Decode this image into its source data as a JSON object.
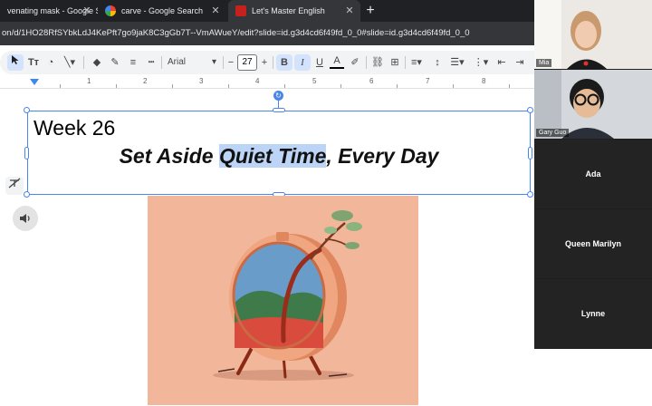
{
  "tabs": [
    {
      "label": "venating mask - Google Se",
      "icon": "google-icon"
    },
    {
      "label": "carve - Google Search",
      "icon": "google-icon"
    },
    {
      "label": "Let's Master English",
      "icon": "slides-icon"
    }
  ],
  "new_tab_glyph": "+",
  "url": "on/d/1HO28RfSYbkLdJ4KePft7go9jaK8C3gGb7T--VmAWueY/edit?slide=id.g3d4cd6f49fd_0_0#slide=id.g3d4cd6f49fd_0_0",
  "toolbar": {
    "font_name": "Arial",
    "font_size": "27",
    "minus": "−",
    "plus": "+",
    "bold": "B",
    "italic": "I",
    "underline": "U",
    "text_color": "A"
  },
  "ruler": {
    "numbers": [
      "1",
      "2",
      "3",
      "4",
      "5",
      "6",
      "7",
      "8"
    ]
  },
  "slide": {
    "week": "Week 26",
    "headline_pre": "Set Aside ",
    "headline_hl": "Quiet Time",
    "headline_post": ", Every Day"
  },
  "participants": [
    {
      "name": "Mia",
      "kind": "video"
    },
    {
      "name": "Gary Guo",
      "kind": "video"
    },
    {
      "name": "Ada",
      "kind": "name"
    },
    {
      "name": "Queen Marilyn",
      "kind": "name"
    },
    {
      "name": "Lynne",
      "kind": "name"
    }
  ],
  "colors": {
    "accent": "#4a86e8",
    "highlight": "#bcd4f6",
    "art_bg": "#f2b79a"
  }
}
